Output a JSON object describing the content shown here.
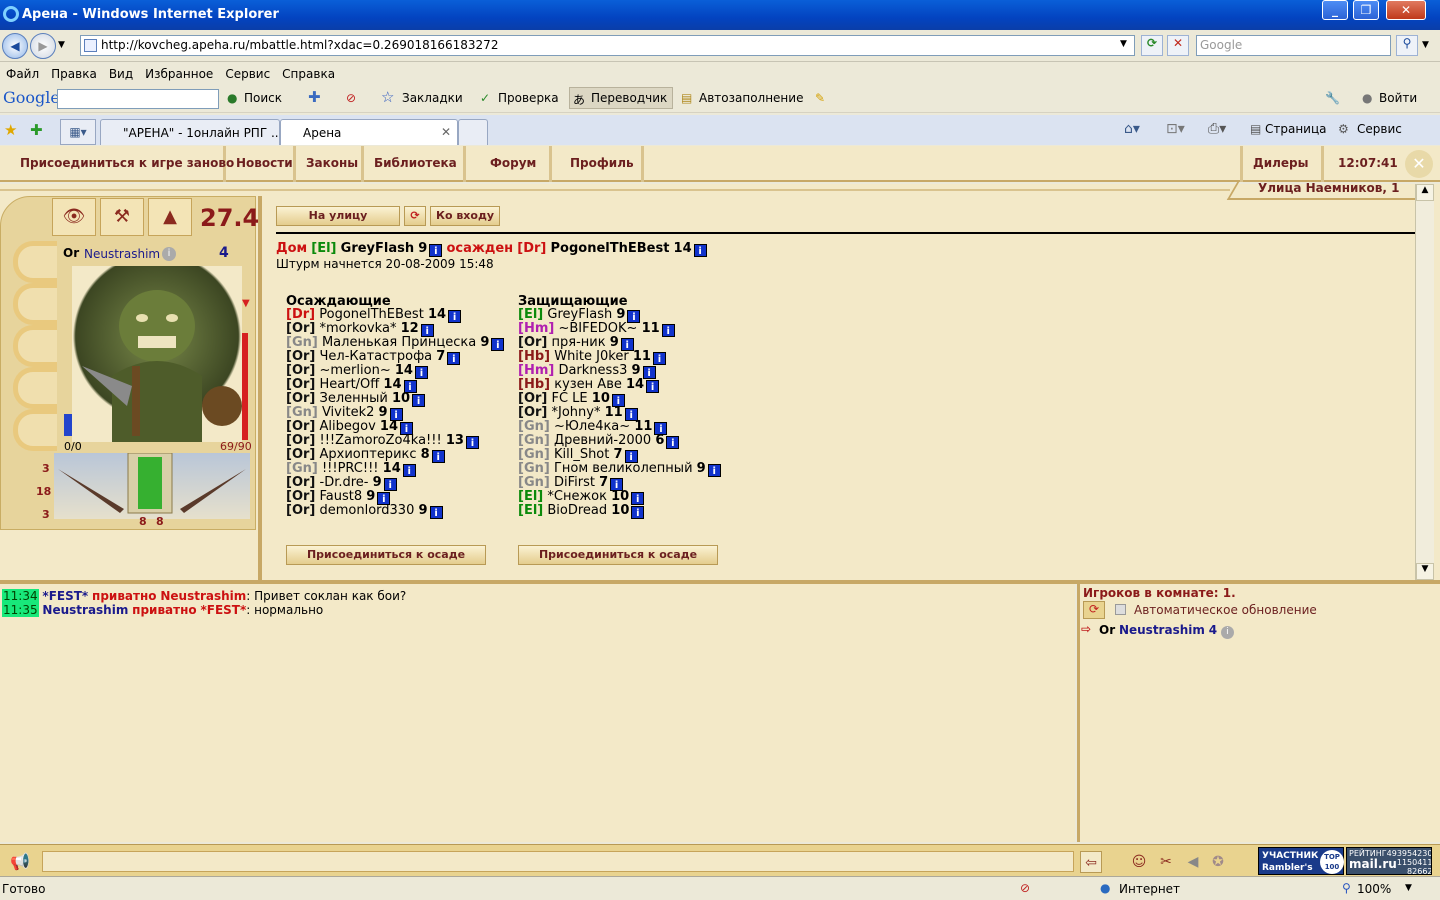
{
  "window": {
    "title": "Арена - Windows Internet Explorer"
  },
  "address": {
    "url": "http://kovcheg.apeha.ru/mbattle.html?xdac=0.269018166183272",
    "search_placeholder": "Google"
  },
  "menu": [
    "Файл",
    "Правка",
    "Вид",
    "Избранное",
    "Сервис",
    "Справка"
  ],
  "google_toolbar": {
    "logo": "Google",
    "search": "Поиск",
    "bookmarks": "Закладки",
    "check": "Проверка",
    "translate": "Переводчик",
    "autofill": "Автозаполнение",
    "signin": "Войти"
  },
  "tabs": [
    {
      "label": "\"АРЕНА\" - 1онлайн РПГ ..."
    },
    {
      "label": "Арена"
    }
  ],
  "tab_tools": {
    "page": "Страница",
    "service": "Сервис"
  },
  "game_nav": {
    "items": [
      "Присоединиться к игре заново",
      "Новости",
      "Законы",
      "Библиотека",
      "Форум",
      "Профиль"
    ],
    "dealers": "Дилеры",
    "clock": "12:07:41",
    "location": "Улица Наемников, 1"
  },
  "character": {
    "level_value": "27.4",
    "race": "Or",
    "name": "Neustrashim",
    "level": "4",
    "mana": "0/0",
    "hp": "69/90",
    "hp_fraction": 0.767,
    "stats": [
      "3",
      "18",
      "3"
    ],
    "bottom_stats": [
      "8",
      "8"
    ]
  },
  "siege": {
    "buttons": {
      "street": "На улицу",
      "entrance": "Ко входу",
      "join": "Присоединиться к осаде"
    },
    "head": {
      "house": "Дом",
      "owner_tag": "[El]",
      "owner": "GreyFlash",
      "owner_level": "9",
      "besieged": "осажден",
      "attacker_tag": "[Dr]",
      "attacker": "PogonelThEBest",
      "attacker_level": "14"
    },
    "start_text": "Штурм начнется 20-08-2009 15:48",
    "attackers_title": "Осаждающие",
    "defenders_title": "Защищающие",
    "attackers": [
      {
        "tag": "[Dr]",
        "clan": "dr",
        "name": "PogonelThEBest",
        "level": "14"
      },
      {
        "tag": "[Or]",
        "clan": "or",
        "name": "*morkovka*",
        "level": "12"
      },
      {
        "tag": "[Gn]",
        "clan": "gn",
        "name": "Маленькая Принцеска",
        "level": "9"
      },
      {
        "tag": "[Or]",
        "clan": "or",
        "name": "Чел-Катастрофа",
        "level": "7"
      },
      {
        "tag": "[Or]",
        "clan": "or",
        "name": "~merlion~",
        "level": "14"
      },
      {
        "tag": "[Or]",
        "clan": "or",
        "name": "Heart/Off",
        "level": "14"
      },
      {
        "tag": "[Or]",
        "clan": "or",
        "name": "Зеленный",
        "level": "10"
      },
      {
        "tag": "[Gn]",
        "clan": "gn",
        "name": "Vivitek2",
        "level": "9"
      },
      {
        "tag": "[Or]",
        "clan": "or",
        "name": "Alibegov",
        "level": "14"
      },
      {
        "tag": "[Or]",
        "clan": "or",
        "name": "!!!ZamoroZo4ka!!!",
        "level": "13"
      },
      {
        "tag": "[Or]",
        "clan": "or",
        "name": "Архиоптерикс",
        "level": "8"
      },
      {
        "tag": "[Gn]",
        "clan": "gn",
        "name": "!!!PRC!!!",
        "level": "14"
      },
      {
        "tag": "[Or]",
        "clan": "or",
        "name": "-Dr.dre-",
        "level": "9"
      },
      {
        "tag": "[Or]",
        "clan": "or",
        "name": "Faust8",
        "level": "9"
      },
      {
        "tag": "[Or]",
        "clan": "or",
        "name": "demonlord330",
        "level": "9"
      }
    ],
    "defenders": [
      {
        "tag": "[El]",
        "clan": "el",
        "name": "GreyFlash",
        "level": "9"
      },
      {
        "tag": "[Hm]",
        "clan": "hm",
        "name": "~BIFEDOK~",
        "level": "11"
      },
      {
        "tag": "[Or]",
        "clan": "or",
        "name": "пря-ник",
        "level": "9"
      },
      {
        "tag": "[Hb]",
        "clan": "hb",
        "name": "White J0ker",
        "level": "11"
      },
      {
        "tag": "[Hm]",
        "clan": "hm",
        "name": "Darkness3",
        "level": "9"
      },
      {
        "tag": "[Hb]",
        "clan": "hb",
        "name": "кузен Аве",
        "level": "14"
      },
      {
        "tag": "[Or]",
        "clan": "or",
        "name": "FC LE",
        "level": "10"
      },
      {
        "tag": "[Or]",
        "clan": "or",
        "name": "*Johny*",
        "level": "11"
      },
      {
        "tag": "[Gn]",
        "clan": "gn",
        "name": "~Юле4ка~",
        "level": "11"
      },
      {
        "tag": "[Gn]",
        "clan": "gn",
        "name": "Древний-2000",
        "level": "6"
      },
      {
        "tag": "[Gn]",
        "clan": "gn",
        "name": "Kill_Shot",
        "level": "7"
      },
      {
        "tag": "[Gn]",
        "clan": "gn",
        "name": "Гном великолепный",
        "level": "9"
      },
      {
        "tag": "[Gn]",
        "clan": "gn",
        "name": "DiFirst",
        "level": "7"
      },
      {
        "tag": "[El]",
        "clan": "el",
        "name": "*Снежок",
        "level": "10"
      },
      {
        "tag": "[El]",
        "clan": "el",
        "name": "BioDread",
        "level": "10"
      }
    ]
  },
  "chat": [
    {
      "time": "11:34",
      "from": "*FEST*",
      "mode": "приватно",
      "to": "Neustrashim",
      "text": ": Привет соклан как бои?"
    },
    {
      "time": "11:35",
      "from": "Neustrashim",
      "mode": "приватно",
      "to": "*FEST*",
      "text": ": нормально"
    }
  ],
  "room": {
    "players": "Игроков в комнате: 1.",
    "auto_update": "Автоматическое обновление",
    "player_race": "Or",
    "player_name": "Neustrashim",
    "player_level": "4"
  },
  "badges": {
    "rambler_top": "УЧАСТНИК",
    "rambler": "Rambler's",
    "rambler_100": "TOP 100",
    "mail_label": "РЕЙТИНГ",
    "mail_brand": "mail.ru",
    "mail_num1": "493954230",
    "mail_num2": "1150411",
    "mail_num3": "82662"
  },
  "status": {
    "left": "Готово",
    "zone": "Интернет",
    "zoom": "100%"
  }
}
